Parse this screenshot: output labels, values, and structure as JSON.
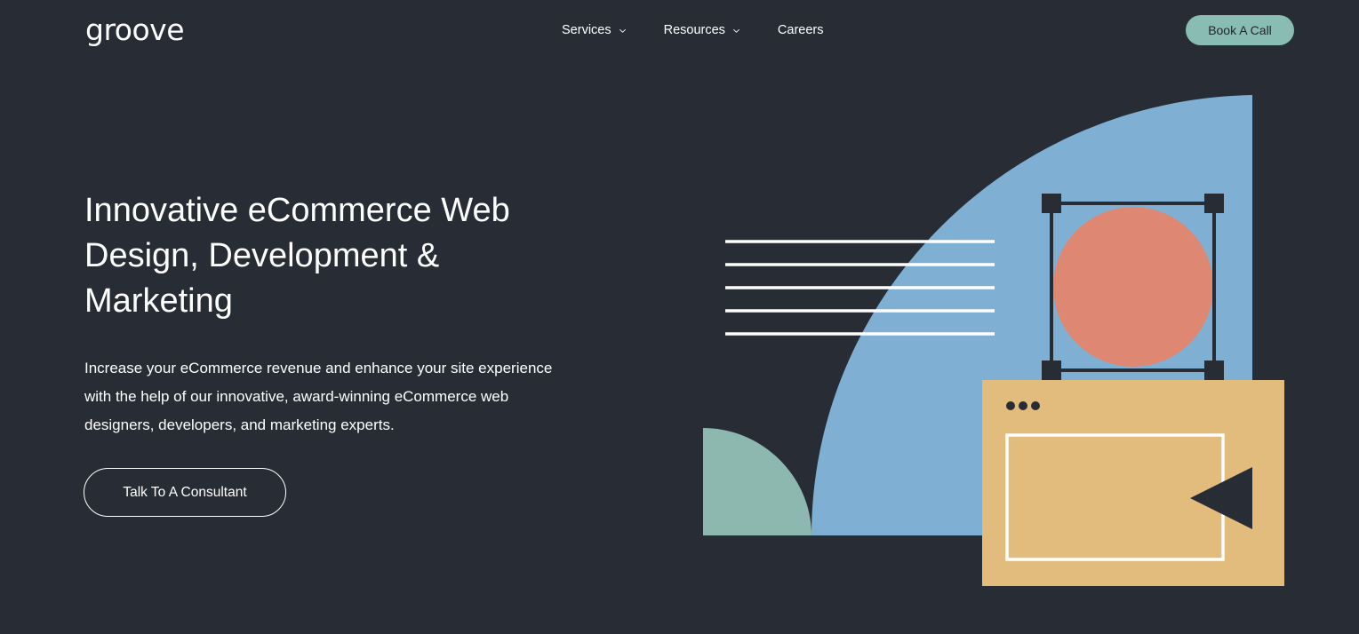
{
  "header": {
    "logo": "groove",
    "nav": [
      {
        "label": "Services",
        "has_dropdown": true
      },
      {
        "label": "Resources",
        "has_dropdown": true
      },
      {
        "label": "Careers",
        "has_dropdown": false
      }
    ],
    "book_call_label": "Book A Call"
  },
  "hero": {
    "title_lines": [
      "Innovative eCommerce Web",
      "Design, Development &",
      "Marketing"
    ],
    "description_lines": [
      "Increase your eCommerce revenue and enhance your site experience",
      "with the help of our innovative, award-winning eCommerce web",
      "designers, developers, and marketing experts."
    ],
    "cta_label": "Talk To A Consultant"
  },
  "colors": {
    "background": "#272c35",
    "accent_teal": "#89bcb2",
    "blue": "#7fb0d4",
    "coral": "#de8873",
    "sand": "#e2bc7c",
    "green": "#8db8b0"
  },
  "illustration": {
    "icons": [
      "dots-icon",
      "play-icon",
      "text-lines-icon",
      "selection-frame-icon"
    ]
  }
}
